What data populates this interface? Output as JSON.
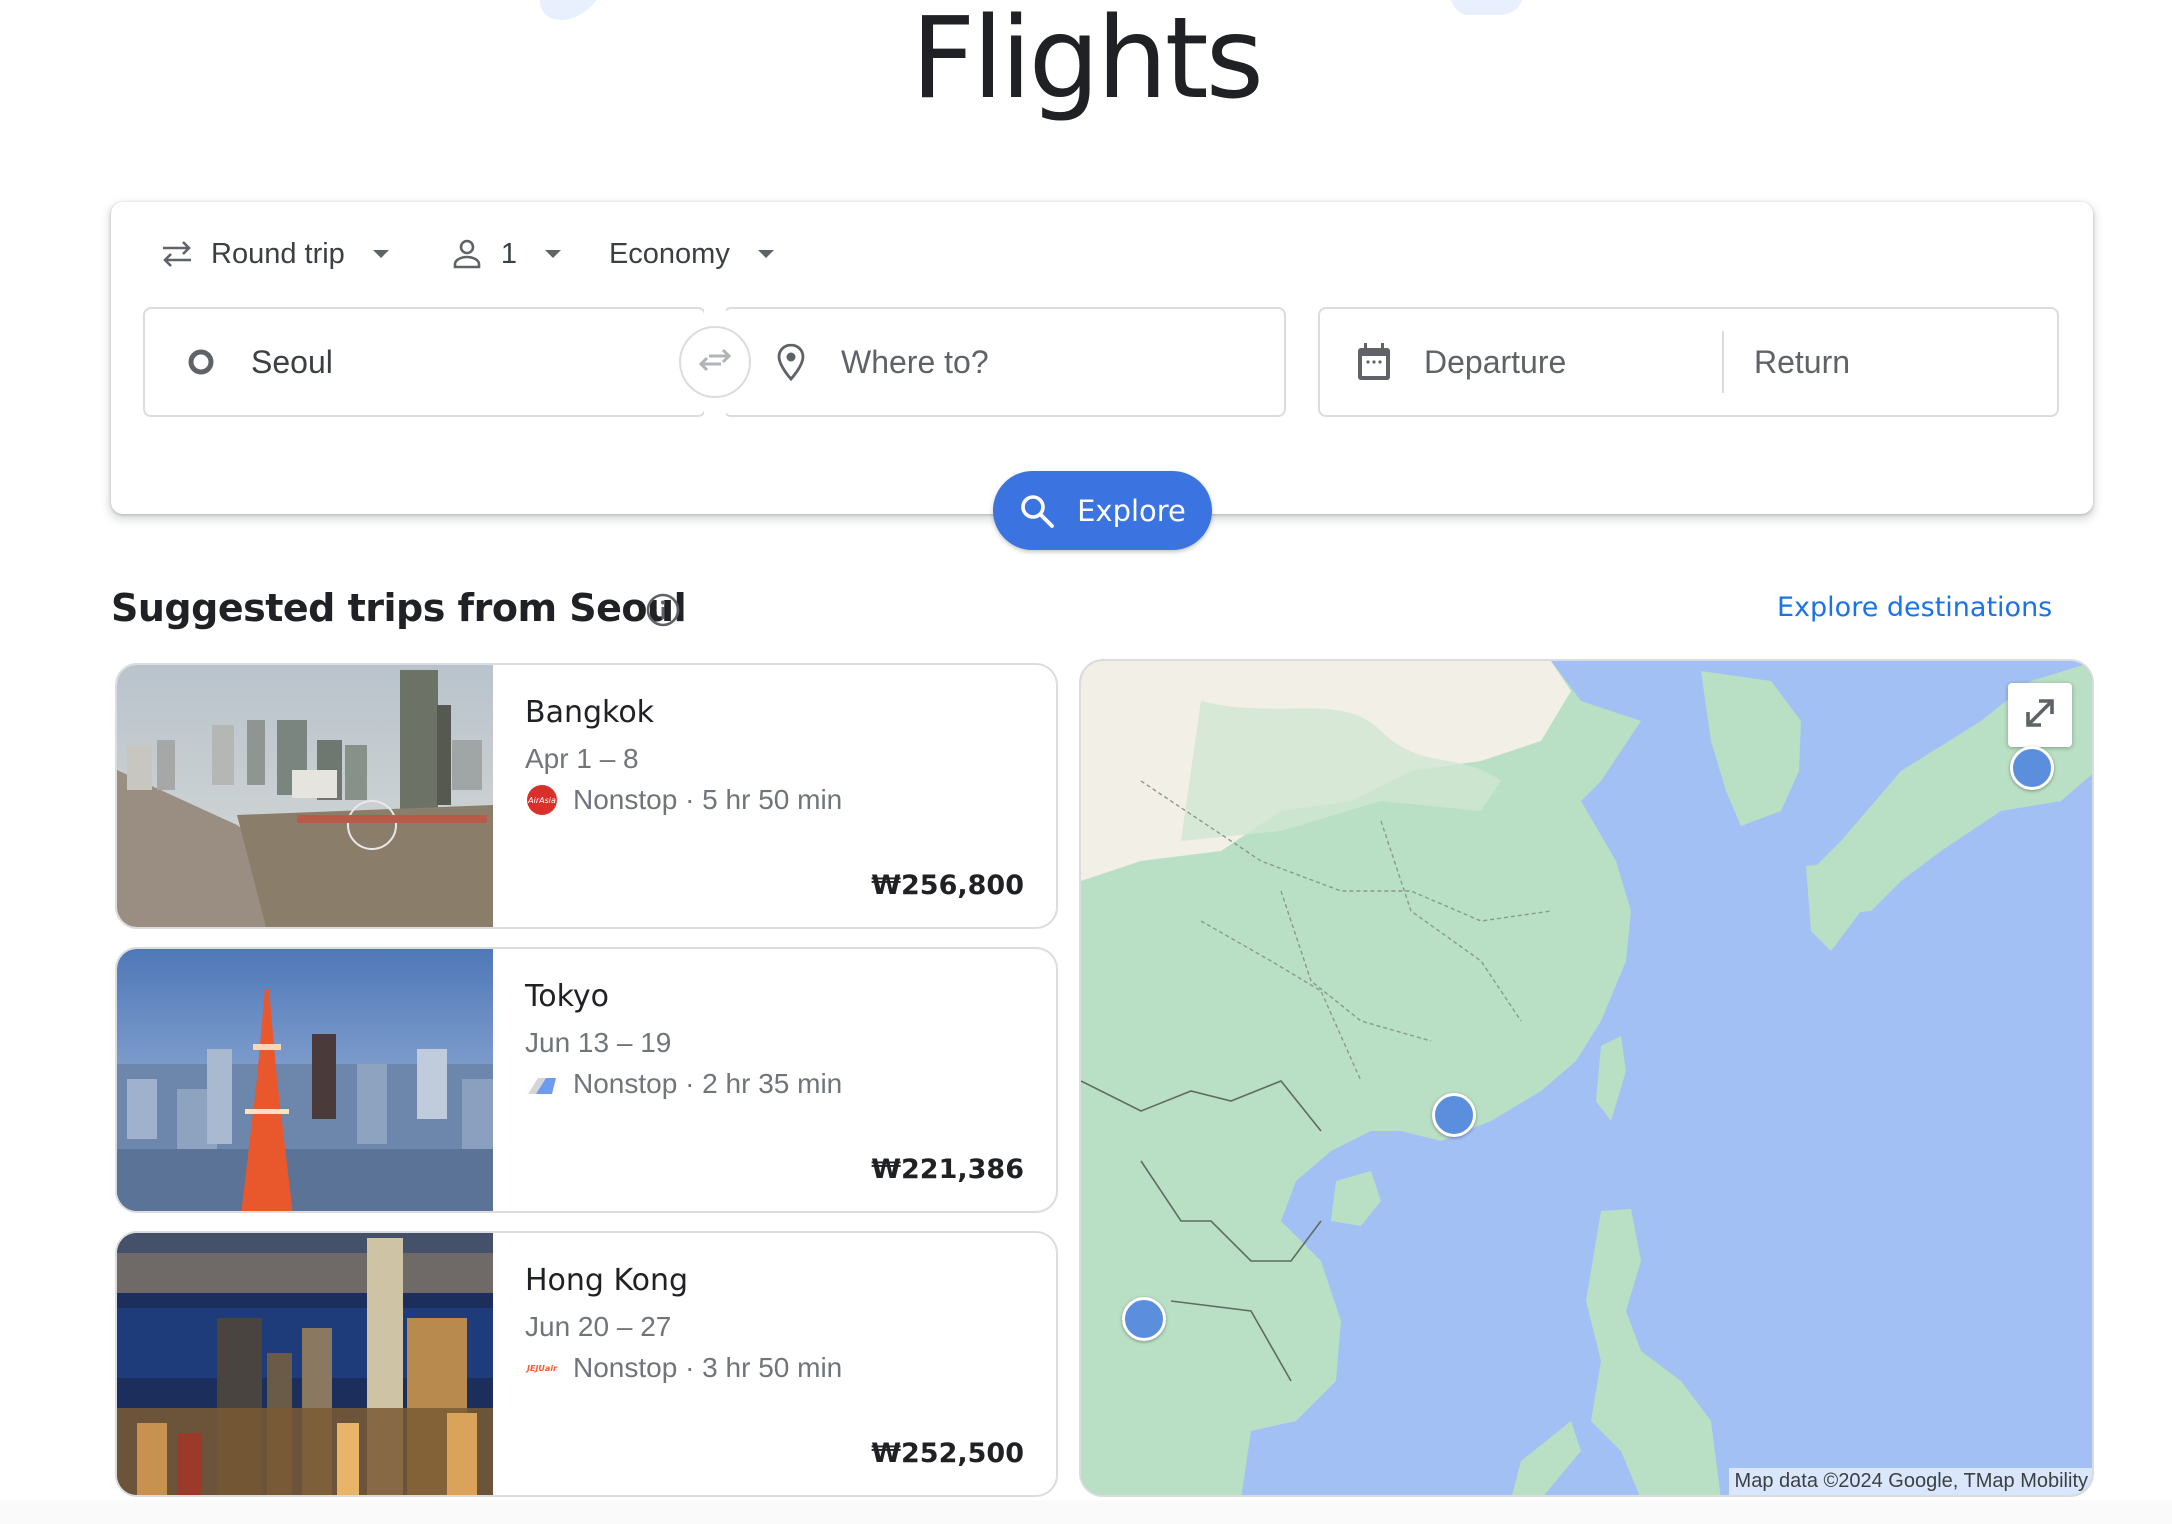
{
  "page": {
    "title": "Flights"
  },
  "search": {
    "trip_type": "Round trip",
    "passengers": "1",
    "cabin_class": "Economy",
    "origin": "Seoul",
    "destination_placeholder": "Where to?",
    "departure_placeholder": "Departure",
    "return_placeholder": "Return",
    "explore_label": "Explore",
    "icons": {
      "trip_type": "swap-horiz-icon",
      "passengers": "person-icon",
      "origin": "circle-origin-icon",
      "swap": "swap-arrows-icon",
      "destination": "location-pin-icon",
      "calendar": "calendar-icon",
      "explore": "search-icon"
    }
  },
  "suggested": {
    "heading": "Suggested trips from Seoul",
    "info_icon": "info-icon",
    "explore_link": "Explore destinations",
    "trips": [
      {
        "city": "Bangkok",
        "dates": "Apr 1 – 8",
        "airline": "AirAsia",
        "flight": "Nonstop · 5 hr 50 min",
        "price": "₩256,800"
      },
      {
        "city": "Tokyo",
        "dates": "Jun 13 – 19",
        "airline": "Air Premia",
        "flight": "Nonstop · 2 hr 35 min",
        "price": "₩221,386"
      },
      {
        "city": "Hong Kong",
        "dates": "Jun 20 – 27",
        "airline": "Jeju Air",
        "flight": "Nonstop · 3 hr 50 min",
        "price": "₩252,500"
      }
    ]
  },
  "map": {
    "attribution": "Map data ©2024 Google, TMap Mobility",
    "expand_icon": "expand-icon",
    "markers": [
      {
        "city": "Tokyo"
      },
      {
        "city": "Hong Kong"
      },
      {
        "city": "Bangkok"
      }
    ]
  },
  "colors": {
    "primary": "#1a73e8",
    "explore_button": "#3b73e0",
    "map_water": "#a3c0f4",
    "map_land": "#b9dfc4",
    "marker": "#5b8edc"
  }
}
